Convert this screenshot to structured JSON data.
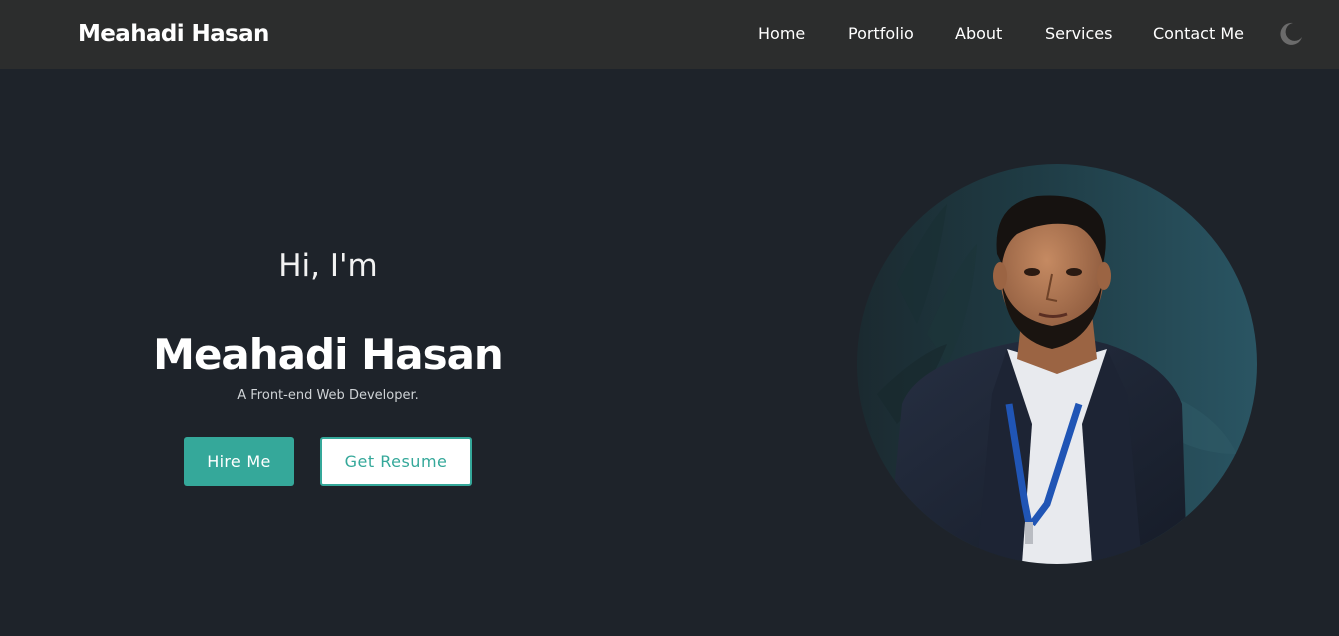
{
  "header": {
    "brand": "Meahadi Hasan",
    "nav": [
      {
        "label": "Home"
      },
      {
        "label": "Portfolio"
      },
      {
        "label": "About"
      },
      {
        "label": "Services"
      },
      {
        "label": "Contact Me"
      }
    ],
    "theme_toggle_icon": "moon-icon"
  },
  "hero": {
    "greeting": "Hi, I'm",
    "name": "Meahadi Hasan",
    "tagline": "A Front-end Web Developer.",
    "hire_button": "Hire Me",
    "resume_button": "Get Resume",
    "portrait_icon": "profile-photo"
  },
  "colors": {
    "background": "#1e232a",
    "navbar": "#2c2d2d",
    "accent": "#35a89a",
    "portrait_circle": "#27505c"
  }
}
